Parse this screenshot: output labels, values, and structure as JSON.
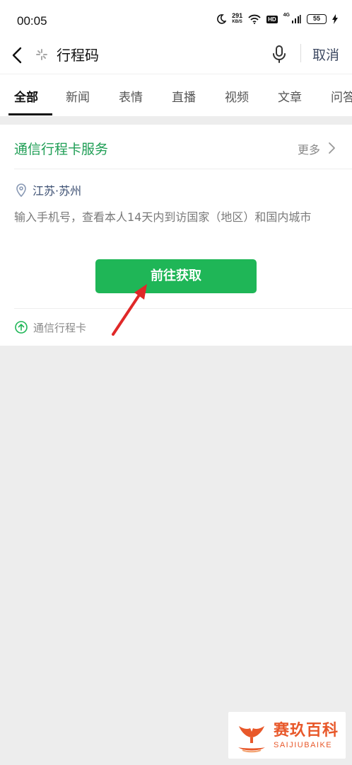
{
  "status_bar": {
    "time": "00:05",
    "net_speed_value": "291",
    "net_speed_unit": "KB/S",
    "hd_badge": "HD",
    "network": "4G",
    "battery": "55"
  },
  "search": {
    "query": "行程码",
    "cancel_label": "取消"
  },
  "tabs": [
    {
      "label": "全部",
      "active": true
    },
    {
      "label": "新闻"
    },
    {
      "label": "表情"
    },
    {
      "label": "直播"
    },
    {
      "label": "视频"
    },
    {
      "label": "文章"
    },
    {
      "label": "问答"
    }
  ],
  "card": {
    "title": "通信行程卡服务",
    "more_label": "更多",
    "location": "江苏·苏州",
    "description": "输入手机号，查看本人14天内到访国家（地区）和国内城市",
    "button_label": "前往获取",
    "footer_label": "通信行程卡"
  },
  "watermark": {
    "name_cn": "赛玖百科",
    "name_en": "SAIJIUBAIKE"
  },
  "colors": {
    "accent_green": "#1fb657",
    "title_green": "#1f9e55",
    "arrow_red": "#e02828",
    "watermark_orange": "#e8582a"
  }
}
